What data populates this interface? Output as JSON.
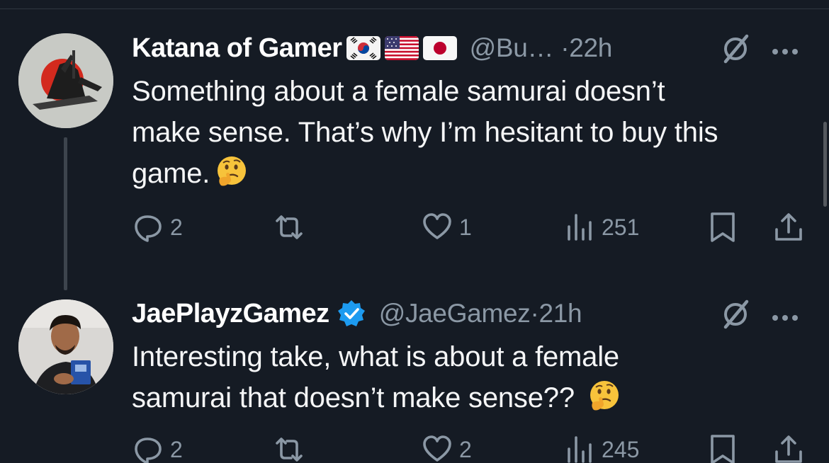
{
  "tweets": [
    {
      "author_name": "Katana of Gamer",
      "flags": [
        "south-korea-flag",
        "united-states-flag",
        "japan-flag"
      ],
      "handle": "@Bu…",
      "separator": "·",
      "time": "22h",
      "text_lines": [
        "Something about a female samurai doesn’t",
        "make sense. That’s why I’m hesitant to buy this",
        "game."
      ],
      "emoji": "thinking-face-emoji",
      "replies": "2",
      "reposts": "",
      "likes": "1",
      "views": "251"
    },
    {
      "author_name": "JaePlayzGamez",
      "verified": true,
      "handle": "@JaeGamez",
      "separator": "·",
      "time": "21h",
      "text_lines": [
        "Interesting take, what is about a female",
        "samurai that doesn’t make sense??"
      ],
      "emoji": "thinking-face-emoji",
      "replies": "2",
      "reposts": "",
      "likes": "2",
      "views": "245"
    }
  ],
  "colors": {
    "background": "#151b24",
    "text": "#f5f6f7",
    "muted": "#8b98a5",
    "verified_blue": "#1d9bf0"
  }
}
